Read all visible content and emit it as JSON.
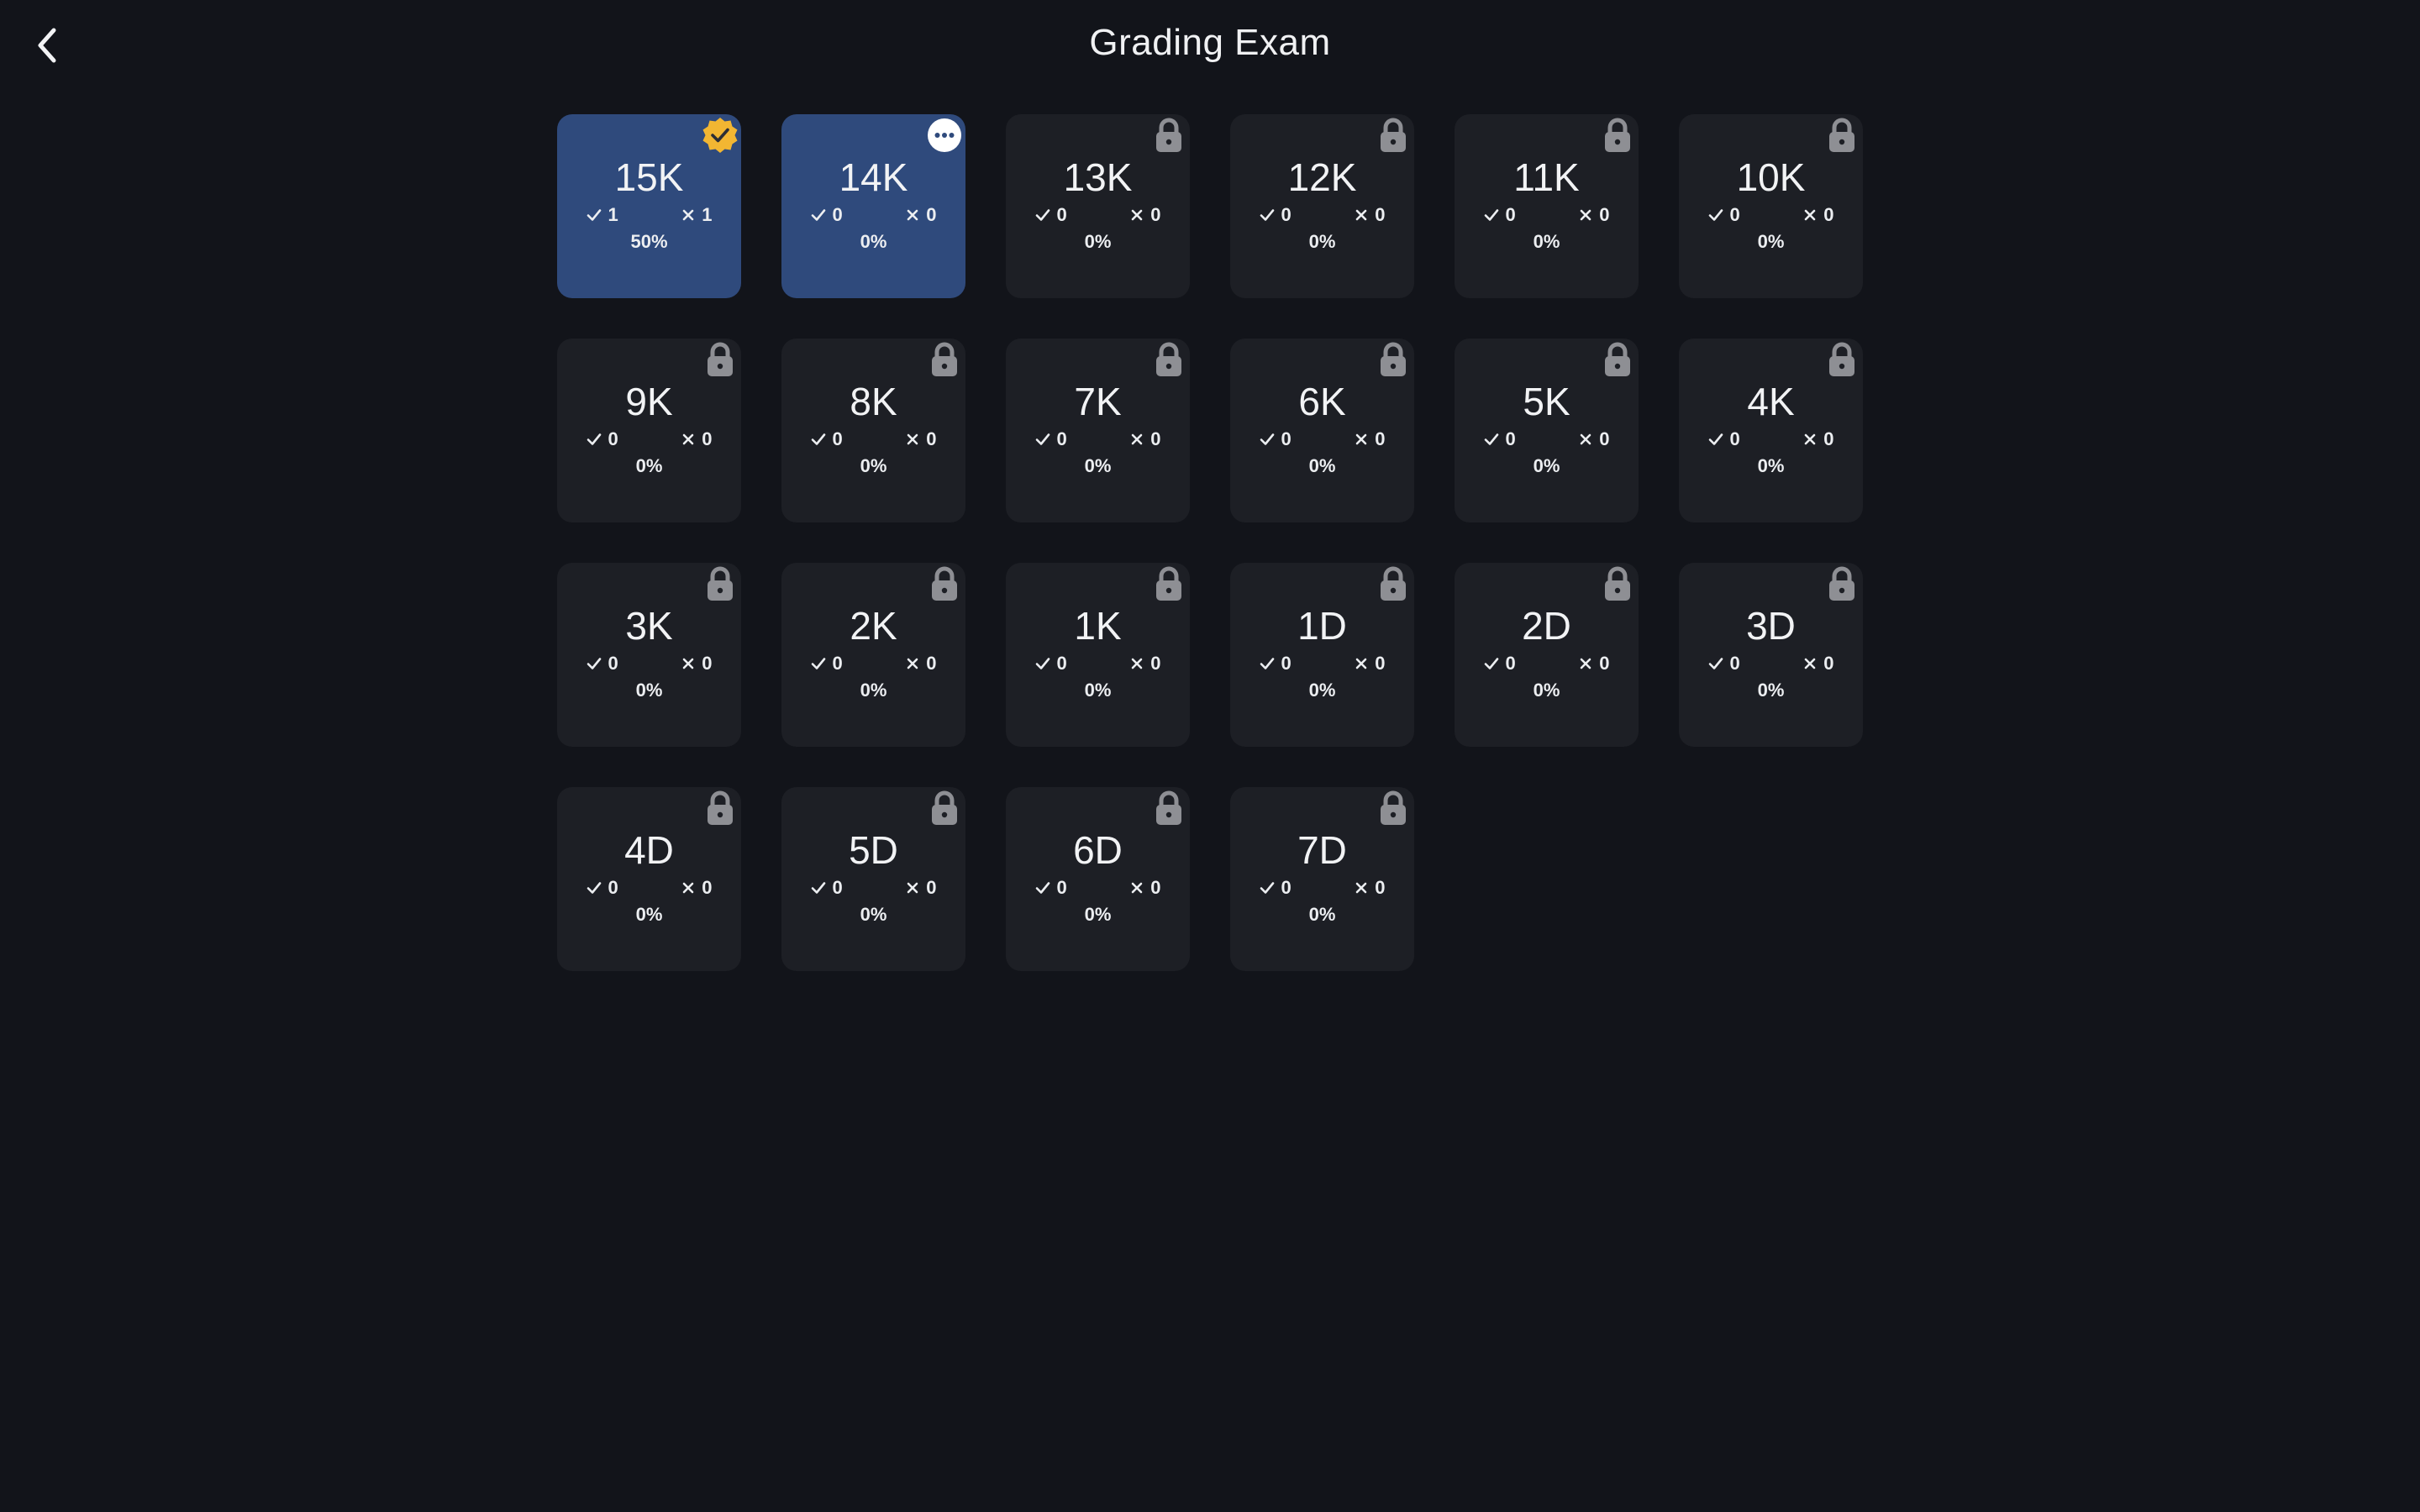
{
  "header": {
    "title": "Grading Exam",
    "back_icon": "chevron-left-icon"
  },
  "colors": {
    "background": "#12141a",
    "card": "#1d1f25",
    "card_active": "#2f4a7c",
    "passed_badge": "#f2b632",
    "lock": "#8e8f94"
  },
  "levels": [
    {
      "label": "15K",
      "correct": "1",
      "wrong": "1",
      "percent": "50%",
      "status": "passed"
    },
    {
      "label": "14K",
      "correct": "0",
      "wrong": "0",
      "percent": "0%",
      "status": "in-progress"
    },
    {
      "label": "13K",
      "correct": "0",
      "wrong": "0",
      "percent": "0%",
      "status": "locked"
    },
    {
      "label": "12K",
      "correct": "0",
      "wrong": "0",
      "percent": "0%",
      "status": "locked"
    },
    {
      "label": "11K",
      "correct": "0",
      "wrong": "0",
      "percent": "0%",
      "status": "locked"
    },
    {
      "label": "10K",
      "correct": "0",
      "wrong": "0",
      "percent": "0%",
      "status": "locked"
    },
    {
      "label": "9K",
      "correct": "0",
      "wrong": "0",
      "percent": "0%",
      "status": "locked"
    },
    {
      "label": "8K",
      "correct": "0",
      "wrong": "0",
      "percent": "0%",
      "status": "locked"
    },
    {
      "label": "7K",
      "correct": "0",
      "wrong": "0",
      "percent": "0%",
      "status": "locked"
    },
    {
      "label": "6K",
      "correct": "0",
      "wrong": "0",
      "percent": "0%",
      "status": "locked"
    },
    {
      "label": "5K",
      "correct": "0",
      "wrong": "0",
      "percent": "0%",
      "status": "locked"
    },
    {
      "label": "4K",
      "correct": "0",
      "wrong": "0",
      "percent": "0%",
      "status": "locked"
    },
    {
      "label": "3K",
      "correct": "0",
      "wrong": "0",
      "percent": "0%",
      "status": "locked"
    },
    {
      "label": "2K",
      "correct": "0",
      "wrong": "0",
      "percent": "0%",
      "status": "locked"
    },
    {
      "label": "1K",
      "correct": "0",
      "wrong": "0",
      "percent": "0%",
      "status": "locked"
    },
    {
      "label": "1D",
      "correct": "0",
      "wrong": "0",
      "percent": "0%",
      "status": "locked"
    },
    {
      "label": "2D",
      "correct": "0",
      "wrong": "0",
      "percent": "0%",
      "status": "locked"
    },
    {
      "label": "3D",
      "correct": "0",
      "wrong": "0",
      "percent": "0%",
      "status": "locked"
    },
    {
      "label": "4D",
      "correct": "0",
      "wrong": "0",
      "percent": "0%",
      "status": "locked"
    },
    {
      "label": "5D",
      "correct": "0",
      "wrong": "0",
      "percent": "0%",
      "status": "locked"
    },
    {
      "label": "6D",
      "correct": "0",
      "wrong": "0",
      "percent": "0%",
      "status": "locked"
    },
    {
      "label": "7D",
      "correct": "0",
      "wrong": "0",
      "percent": "0%",
      "status": "locked"
    }
  ]
}
